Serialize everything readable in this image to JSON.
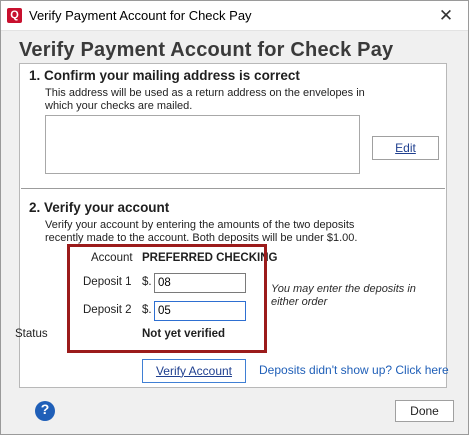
{
  "window": {
    "title": "Verify Payment Account for Check Pay",
    "app_icon_letter": "Q",
    "close_glyph": "✕"
  },
  "page_title": "Verify Payment Account for Check Pay",
  "section1": {
    "heading": "1. Confirm your mailing address is correct",
    "description_line1": "This address will be used as a return address on the envelopes in",
    "description_line2": "which your checks are mailed.",
    "address_value": "",
    "edit_label": "Edit"
  },
  "section2": {
    "heading": "2. Verify your account",
    "description_line1": "Verify your account by entering the amounts of the two deposits",
    "description_line2": "recently made to the account. Both deposits will be under $1.00.",
    "account_label": "Account",
    "account_value": "PREFERRED CHECKING",
    "deposit1_label": "Deposit 1",
    "deposit2_label": "Deposit 2",
    "currency_prefix": "$.",
    "deposit1_value": "08",
    "deposit2_value": "05",
    "hint_line1": "You may enter the deposits in",
    "hint_line2": "either order",
    "status_label": "Status",
    "status_value": "Not yet verified",
    "verify_button": "Verify Account",
    "deposits_link": "Deposits didn't show up?  Click here"
  },
  "footer": {
    "help_glyph": "?",
    "done_button": "Done"
  },
  "colors": {
    "highlight_frame": "#9b1b1b",
    "link": "#1f5fb8",
    "app_icon": "#c8102e"
  },
  "icons": {
    "app": "quicken-app-icon",
    "close": "close-icon",
    "help": "help-icon"
  }
}
